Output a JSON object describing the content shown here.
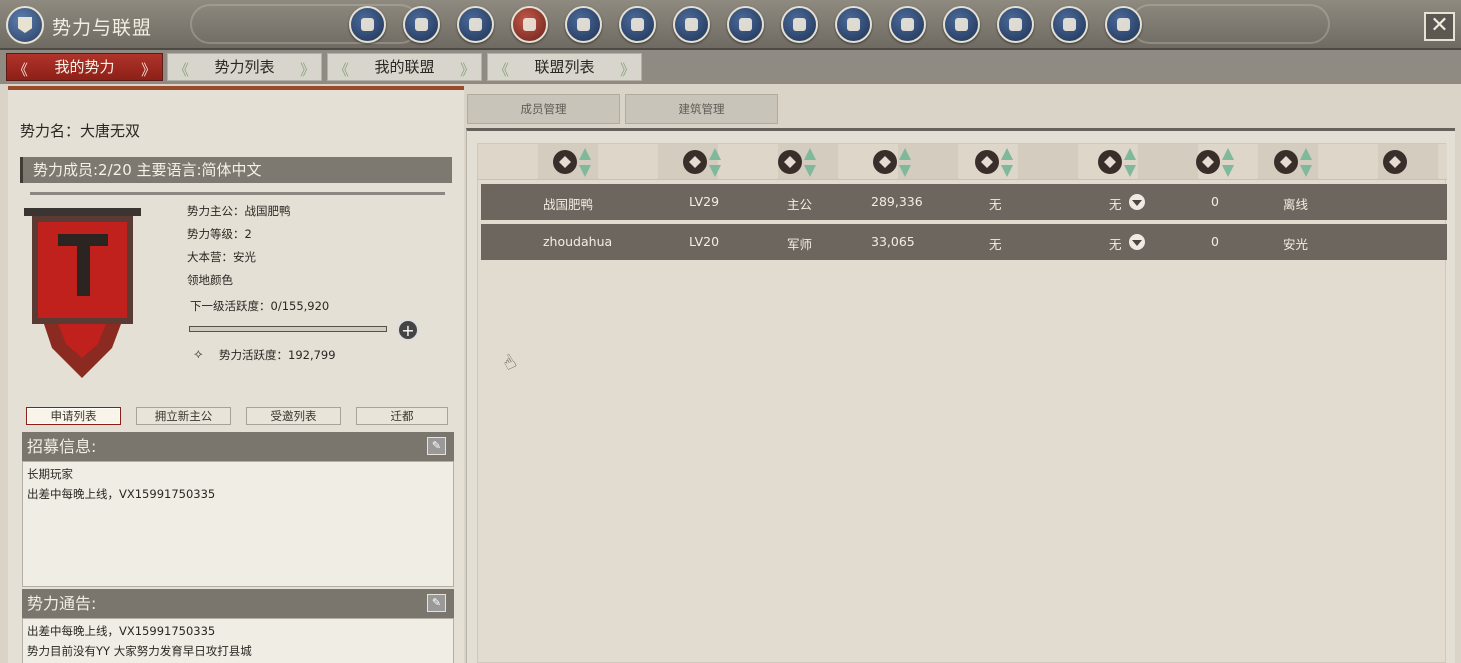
{
  "app": {
    "title": "势力与联盟",
    "close": "✕"
  },
  "nav_icons": [
    "general-icon",
    "network-icon",
    "helmet-icon",
    "banner-icon",
    "hand-icon",
    "warrior-icon",
    "target-icon",
    "dragon-icon",
    "face-icon",
    "scroll-icon",
    "map-icon",
    "book-icon",
    "letter-icon",
    "tablet-icon",
    "city-icon"
  ],
  "tabs": [
    {
      "label": "我的势力",
      "active": true
    },
    {
      "label": "势力列表",
      "active": false
    },
    {
      "label": "我的联盟",
      "active": false
    },
    {
      "label": "联盟列表",
      "active": false
    }
  ],
  "faction": {
    "name_line": "势力名：大唐无双",
    "members_line": "势力成员:2/20  主要语言:简体中文",
    "leader": "势力主公：战国肥鸭",
    "level": "势力等级：2",
    "base": "大本营：安光",
    "color": "领地颜色",
    "next_activity": "下一级活跃度：0/155,920",
    "progress": 0,
    "activity": "势力活跃度：192,799",
    "banner_letter": "T",
    "banner_color": "#c0211c"
  },
  "sub_buttons": [
    "申请列表",
    "拥立新主公",
    "受邀列表",
    "迁都"
  ],
  "recruit": {
    "heading": "招募信息:",
    "lines": [
      "长期玩家",
      "出差中每晚上线，VX15991750335"
    ]
  },
  "notice": {
    "heading": "势力通告:",
    "lines": [
      "出差中每晚上线，VX15991750335",
      "势力目前没有YY   大家努力发育早日攻打县城"
    ]
  },
  "right_subtabs": [
    "成员管理",
    "建筑管理"
  ],
  "columns": [
    "name-col-icon",
    "level-col-icon",
    "role-col-icon",
    "power-col-icon",
    "office-col-icon",
    "title-col-icon",
    "contribution-col-icon",
    "location-col-icon",
    "status-col-icon"
  ],
  "members": [
    {
      "name": "战国肥鸭",
      "level": "LV29",
      "role": "主公",
      "power": "289,336",
      "office": "无",
      "title": "无",
      "contrib": "0",
      "status": "离线"
    },
    {
      "name": "zhoudahua",
      "level": "LV20",
      "role": "军师",
      "power": "33,065",
      "office": "无",
      "title": "无",
      "contrib": "0",
      "status": "安光"
    }
  ]
}
